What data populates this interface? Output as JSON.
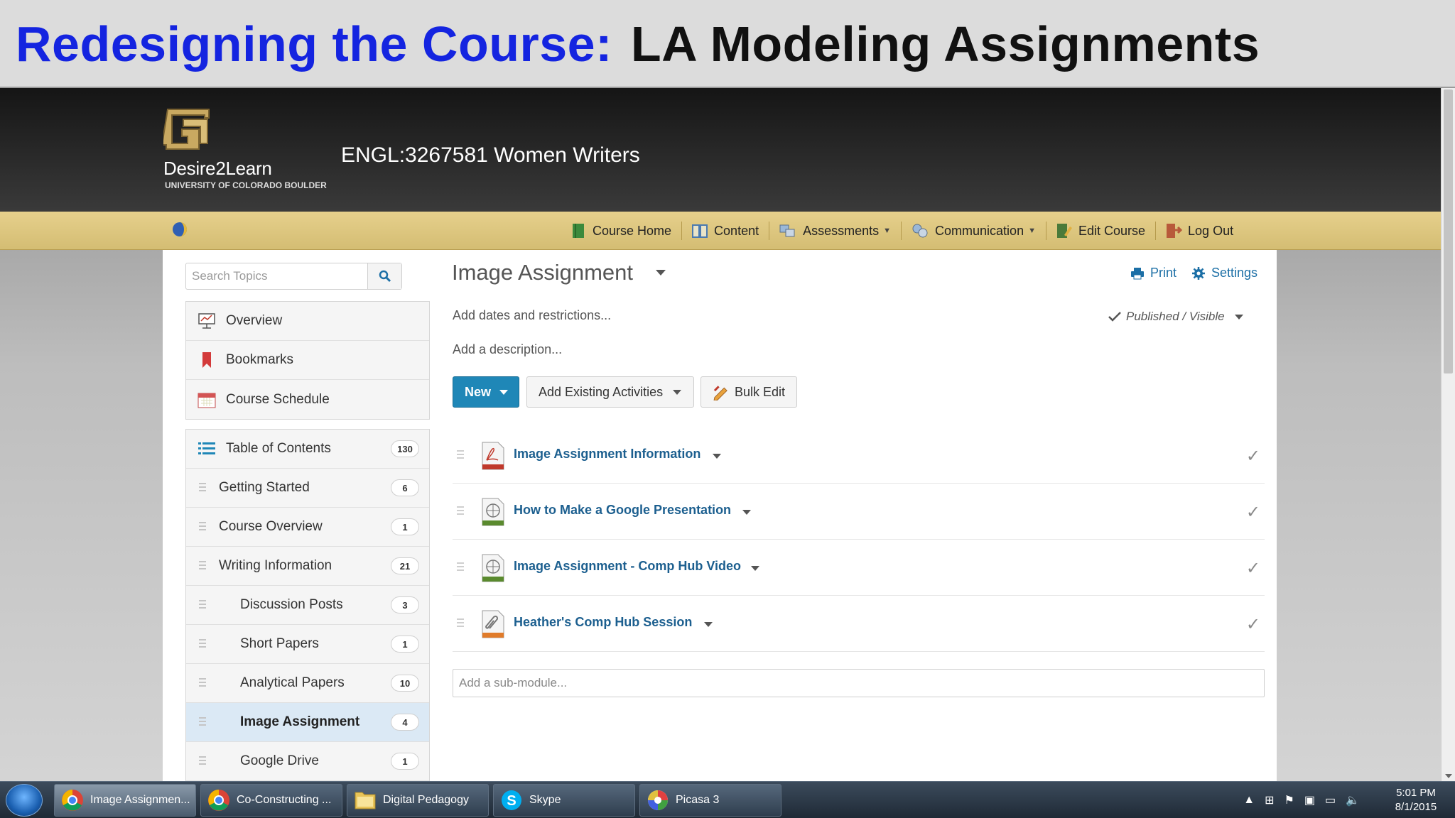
{
  "slide": {
    "title_part1": "Redesigning the Course:",
    "title_part2": "LA Modeling Assignments"
  },
  "header": {
    "brand": "Desire2Learn",
    "brand_sub": "UNIVERSITY OF COLORADO BOULDER",
    "course_title": "ENGL:3267581 Women Writers"
  },
  "navbar": {
    "items": [
      {
        "label": "Course Home",
        "icon": "course-home-icon",
        "caret": false
      },
      {
        "label": "Content",
        "icon": "content-book-icon",
        "caret": false
      },
      {
        "label": "Assessments",
        "icon": "assessments-icon",
        "caret": true
      },
      {
        "label": "Communication",
        "icon": "communication-icon",
        "caret": true
      },
      {
        "label": "Edit Course",
        "icon": "edit-course-icon",
        "caret": false
      },
      {
        "label": "Log Out",
        "icon": "log-out-icon",
        "caret": false
      }
    ]
  },
  "sidebar": {
    "search_placeholder": "Search Topics",
    "top_items": [
      {
        "label": "Overview",
        "icon": "overview-icon"
      },
      {
        "label": "Bookmarks",
        "icon": "bookmark-icon"
      },
      {
        "label": "Course Schedule",
        "icon": "calendar-icon"
      }
    ],
    "toc_title": "Table of Contents",
    "toc_count": "130",
    "modules": [
      {
        "label": "Getting Started",
        "count": "6",
        "indent": 0,
        "active": false
      },
      {
        "label": "Course Overview",
        "count": "1",
        "indent": 0,
        "active": false
      },
      {
        "label": "Writing Information",
        "count": "21",
        "indent": 0,
        "active": false
      },
      {
        "label": "Discussion Posts",
        "count": "3",
        "indent": 1,
        "active": false
      },
      {
        "label": "Short Papers",
        "count": "1",
        "indent": 1,
        "active": false
      },
      {
        "label": "Analytical Papers",
        "count": "10",
        "indent": 1,
        "active": false
      },
      {
        "label": "Image Assignment",
        "count": "4",
        "indent": 1,
        "active": true
      },
      {
        "label": "Google Drive",
        "count": "1",
        "indent": 1,
        "active": false
      }
    ]
  },
  "main": {
    "title": "Image Assignment",
    "print_label": "Print",
    "settings_label": "Settings",
    "add_dates": "Add dates and restrictions...",
    "add_description": "Add a description...",
    "status": "Published / Visible",
    "buttons": {
      "new_label": "New",
      "add_existing_label": "Add Existing Activities",
      "bulk_edit_label": "Bulk Edit"
    },
    "topics": [
      {
        "label": "Image Assignment Information",
        "icon": "pdf-file-icon",
        "accent": "#c0392b"
      },
      {
        "label": "How to Make a Google Presentation",
        "icon": "web-link-icon",
        "accent": "#5a8a2e"
      },
      {
        "label": "Image Assignment - Comp Hub Video",
        "icon": "web-link-icon",
        "accent": "#5a8a2e"
      },
      {
        "label": "Heather's Comp Hub Session",
        "icon": "attachment-icon",
        "accent": "#e07b2a"
      }
    ],
    "submodule_placeholder": "Add a sub-module..."
  },
  "taskbar": {
    "items": [
      {
        "label": "Image Assignmen...",
        "icon": "chrome-icon",
        "active": true
      },
      {
        "label": "Co-Constructing ...",
        "icon": "chrome-icon",
        "active": false
      },
      {
        "label": "Digital Pedagogy",
        "icon": "folder-icon",
        "active": false
      },
      {
        "label": "Skype",
        "icon": "skype-icon",
        "active": false
      },
      {
        "label": "Picasa 3",
        "icon": "picasa-icon",
        "active": false
      }
    ],
    "time": "5:01 PM",
    "date": "8/1/2015"
  },
  "colors": {
    "slide_title_blue": "#1424e0",
    "navbar_gold": "#d9c27c",
    "link_blue": "#1c5f8f",
    "primary_button": "#1f87b7"
  }
}
